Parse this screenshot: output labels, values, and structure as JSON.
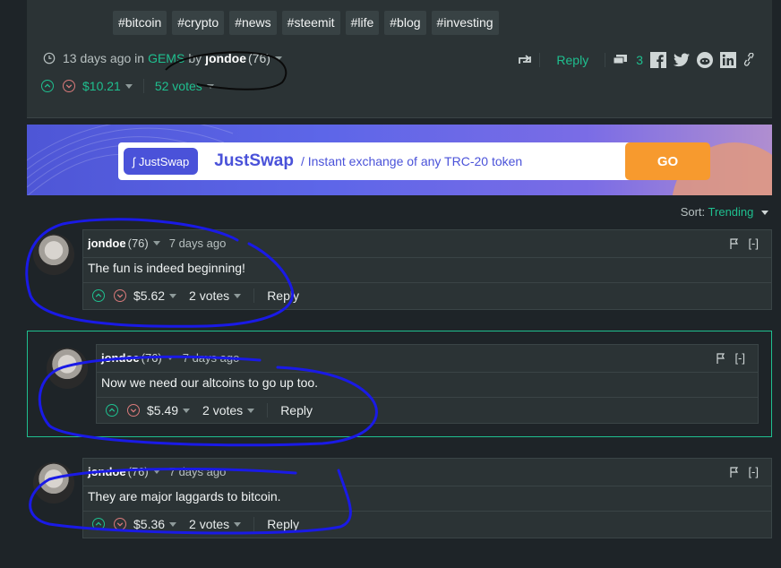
{
  "post": {
    "tags": [
      "#bitcoin",
      "#crypto",
      "#news",
      "#steemit",
      "#life",
      "#blog",
      "#investing"
    ],
    "time_text": "13 days ago in",
    "community": "GEMS",
    "by_text": "by",
    "author": "jondoe",
    "reputation": "(76)",
    "payout": "$10.21",
    "votes": "52 votes",
    "reply_label": "Reply",
    "comment_count": "3"
  },
  "banner": {
    "logo_text": "JustSwap",
    "title": "JustSwap",
    "tagline": "/ Instant exchange of any TRC-20 token",
    "go_label": "GO"
  },
  "sort": {
    "label": "Sort:",
    "value": "Trending"
  },
  "comments": [
    {
      "author": "jondoe",
      "reputation": "(76)",
      "time": "7 days ago",
      "body": "The fun is indeed beginning!",
      "payout": "$5.62",
      "votes": "2 votes",
      "reply_label": "Reply",
      "collapse": "[-]"
    },
    {
      "author": "jondoe",
      "reputation": "(76)",
      "time": "7 days ago",
      "body": "Now we need our altcoins to go up too.",
      "payout": "$5.49",
      "votes": "2 votes",
      "reply_label": "Reply",
      "collapse": "[-]"
    },
    {
      "author": "jondoe",
      "reputation": "(76)",
      "time": "7 days ago",
      "body": "They are major laggards to bitcoin.",
      "payout": "$5.36",
      "votes": "2 votes",
      "reply_label": "Reply",
      "collapse": "[-]"
    }
  ],
  "colors": {
    "accent": "#1fbf8f",
    "downvote": "#d97a7a",
    "annotation": "#1a1ae6",
    "banner": "#4a52d9",
    "go": "#f79a2e"
  }
}
